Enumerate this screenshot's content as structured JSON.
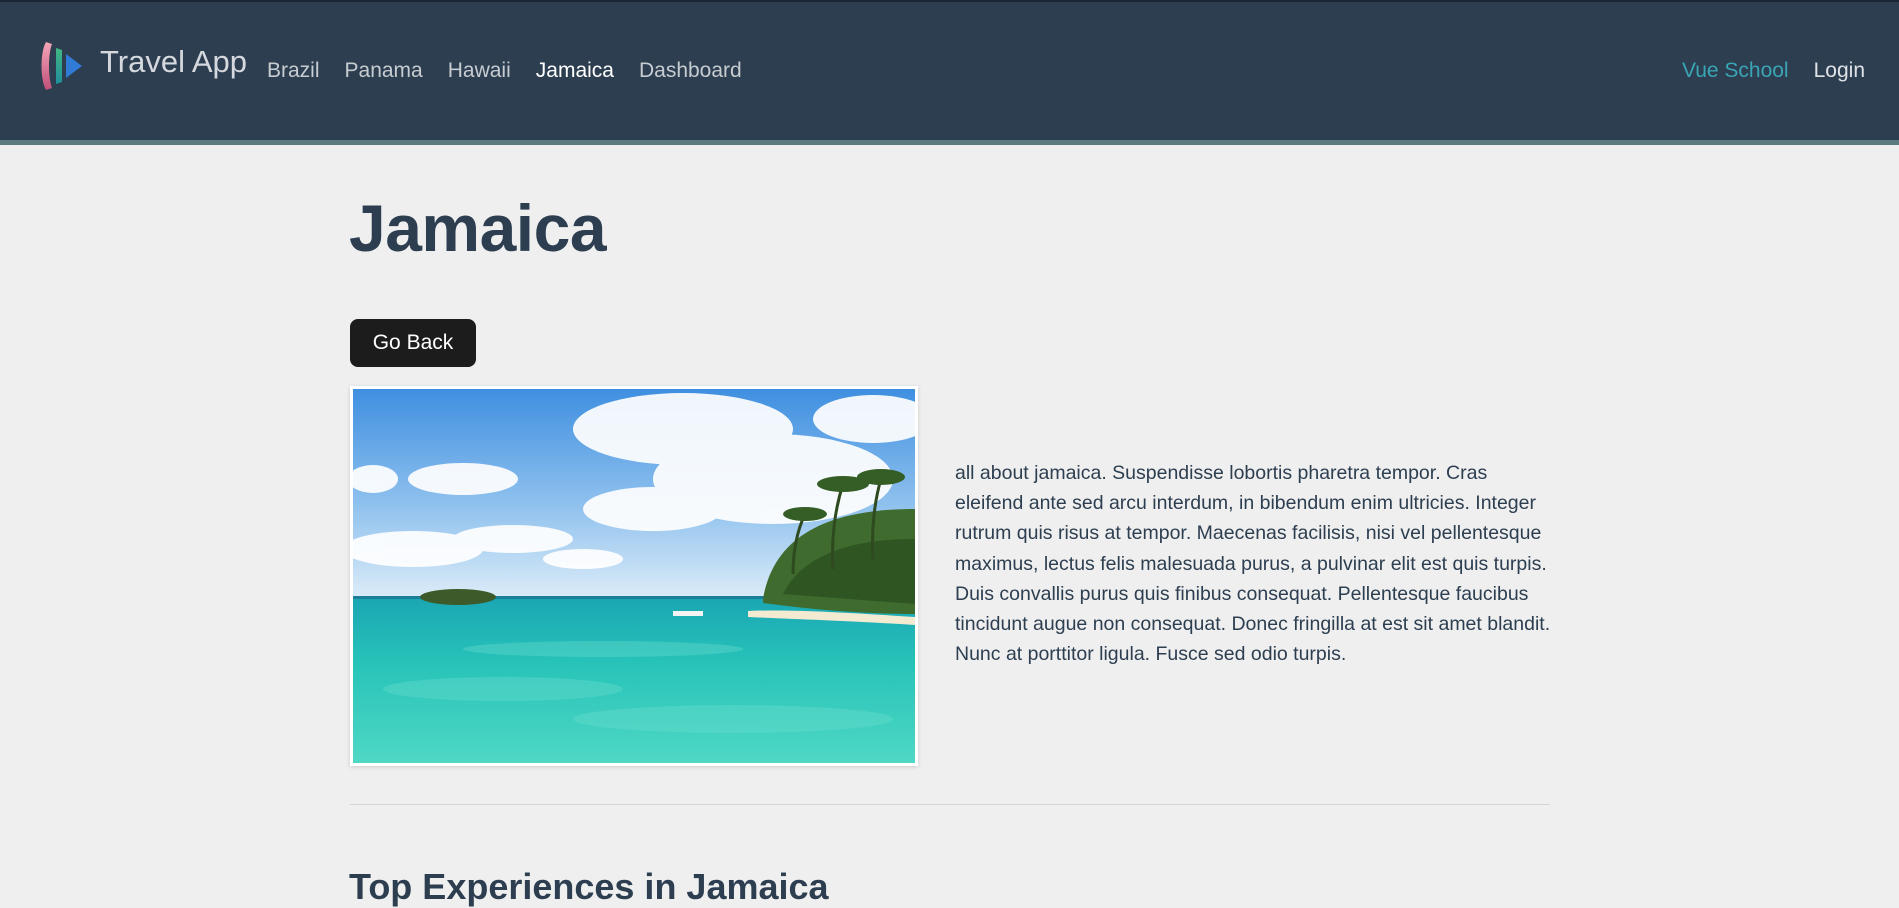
{
  "header": {
    "brand": "Travel App",
    "nav": [
      {
        "label": "Brazil",
        "active": false
      },
      {
        "label": "Panama",
        "active": false
      },
      {
        "label": "Hawaii",
        "active": false
      },
      {
        "label": "Jamaica",
        "active": true
      },
      {
        "label": "Dashboard",
        "active": false
      }
    ],
    "right_links": {
      "vue_school": "Vue School",
      "login": "Login"
    }
  },
  "main": {
    "title": "Jamaica",
    "back_button": "Go Back",
    "description": "all about jamaica. Suspendisse lobortis pharetra tempor. Cras eleifend ante sed arcu interdum, in bibendum enim ultricies. Integer rutrum quis risus at tempor. Maecenas facilisis, nisi vel pellentesque maximus, lectus felis malesuada purus, a pulvinar elit est quis turpis. Duis convallis purus quis finibus consequat. Pellentesque faucibus tincidunt augue non consequat. Donec fringilla at est sit amet blandit. Nunc at porttitor ligula. Fusce sed odio turpis.",
    "next_section_heading": "Top Experiences in Jamaica"
  },
  "colors": {
    "header_bg": "#2c3e50",
    "accent_link": "#3aa5b4",
    "page_bg": "#efefef",
    "button_bg": "#1c1c1c"
  },
  "icons": [
    "vue-school-logo-icon"
  ],
  "image": {
    "alt": "tropical beach with turquoise water and palm trees"
  }
}
